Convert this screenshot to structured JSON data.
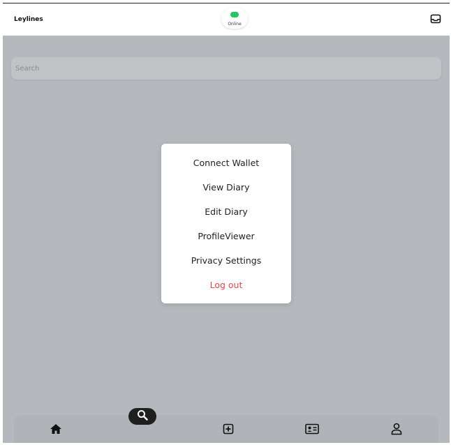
{
  "header": {
    "app_title": "Leylines",
    "status_label": "Online",
    "status_color": "#22c55e",
    "inbox_icon": "inbox-icon"
  },
  "search": {
    "placeholder": "Search",
    "value": ""
  },
  "menu": {
    "items": [
      {
        "label": "Connect Wallet"
      },
      {
        "label": "View Diary"
      },
      {
        "label": "Edit Diary"
      },
      {
        "label": "ProfileViewer"
      },
      {
        "label": "Privacy Settings"
      },
      {
        "label": "Log out",
        "color": "#e5484d"
      }
    ]
  },
  "tabbar": {
    "tabs": [
      {
        "icon": "home-icon"
      },
      {
        "icon": "search-icon",
        "active": true
      },
      {
        "icon": "plus-square-icon"
      },
      {
        "icon": "id-card-icon"
      },
      {
        "icon": "user-icon"
      }
    ]
  },
  "colors": {
    "overlay": "#b5b8bc",
    "tabbar": "#b0b3b7",
    "active_tab_bubble": "#1f1f1f",
    "danger": "#e5484d"
  }
}
